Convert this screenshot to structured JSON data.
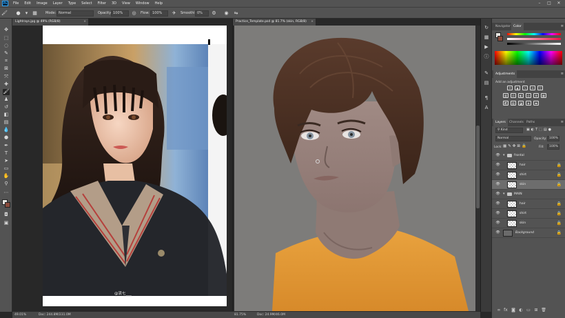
{
  "menubar": {
    "logo": "Ps",
    "items": [
      "File",
      "Edit",
      "Image",
      "Layer",
      "Type",
      "Select",
      "Filter",
      "3D",
      "View",
      "Window",
      "Help"
    ]
  },
  "options": {
    "mode_label": "Mode:",
    "mode_value": "Normal",
    "opacity_label": "Opacity:",
    "opacity_value": "100%",
    "flow_label": "Flow:",
    "flow_value": "100%",
    "smoothing_label": "Smoothing:",
    "smoothing_value": "0%"
  },
  "doc1": {
    "tab_title": "Lightrays.jpg @ 49% (RGB/8)",
    "zoom": "49.01%",
    "doc_size": "Doc: 244.8M/231.0M",
    "watermark": "@流七___"
  },
  "doc2": {
    "tab_title": "Practice_Template.psd @ 81.7% (skin, RGB/8)",
    "zoom": "81.75%",
    "doc_size": "Doc: 24.9M/46.0M"
  },
  "color_panel": {
    "tabs": [
      "Navigator",
      "Color"
    ],
    "active": "Color"
  },
  "adjustments": {
    "title": "Adjustments",
    "hint": "Add an adjustment"
  },
  "layers_panel": {
    "tabs": [
      "Layers",
      "Channels",
      "Paths"
    ],
    "kind_label": "Kind",
    "blend_mode": "Normal",
    "opacity_label": "Opacity:",
    "opacity_value": "100%",
    "lock_label": "Lock:",
    "fill_label": "Fill:",
    "fill_value": "100%",
    "layers": [
      {
        "name": "frontal",
        "type": "group"
      },
      {
        "name": "hair",
        "type": "layer"
      },
      {
        "name": "shirt",
        "type": "layer"
      },
      {
        "name": "skin",
        "type": "layer",
        "selected": true
      },
      {
        "name": "MAIN",
        "type": "group"
      },
      {
        "name": "hair",
        "type": "layer"
      },
      {
        "name": "shirt",
        "type": "layer"
      },
      {
        "name": "skin",
        "type": "layer"
      },
      {
        "name": "Background",
        "type": "background"
      }
    ]
  },
  "colors": {
    "ui_bg": "#535353",
    "dark_bg": "#282828",
    "accent": "#31a8ff",
    "shirt": "#e9a33f",
    "hair": "#4a3125"
  }
}
